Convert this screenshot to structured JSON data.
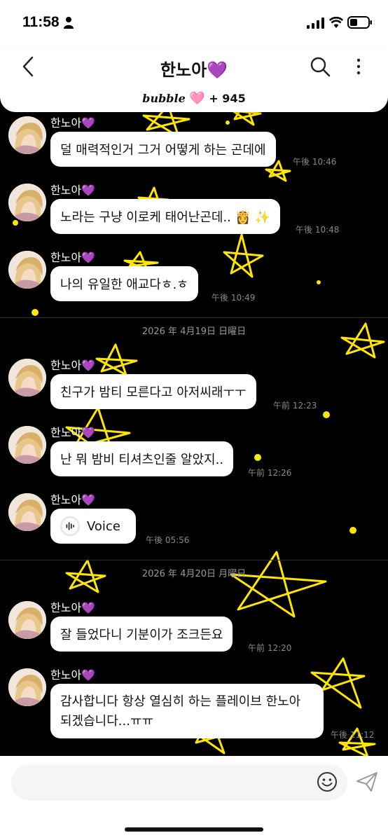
{
  "status": {
    "time": "11:58"
  },
  "header": {
    "title": "한노아💜",
    "bubble_word": "bubble",
    "bubble_heart": "🩷",
    "bubble_count": "+ 945"
  },
  "messages": [
    {
      "name": "한노아💜",
      "text": "덜 매력적인거 그거 어떻게 하는 곤데에",
      "time": "午後 10:46"
    },
    {
      "name": "한노아💜",
      "text": "노라는 구냥 이로케 태어난곤데.. 👸 ✨",
      "time": "午後 10:48"
    },
    {
      "name": "한노아💜",
      "text": "나의 유일한 애교다ㅎ.ㅎ",
      "time": "午後 10:49"
    },
    {
      "name": "한노아💜",
      "text": "친구가 밤티 모른다고 아저씨래ㅜㅜ",
      "time": "午前 12:23"
    },
    {
      "name": "한노아💜",
      "text": "난 뭐 밤비 티셔츠인줄 알았지..",
      "time": "午前 12:26"
    },
    {
      "name": "한노아💜",
      "text": "Voice",
      "time": "午後 05:56"
    },
    {
      "name": "한노아💜",
      "text": "잘 들었다니 기분이가 조크든요",
      "time": "午前 12:20"
    },
    {
      "name": "한노아💜",
      "text_line1": "감사합니다 항상 열심히 하는 플레이브 한노아",
      "text_line2": "되겠습니다...ㅠㅠ",
      "time": "午後 11:12"
    }
  ],
  "dates": [
    "2026 年 4月19日 日曜日",
    "2026 年 4月20日 月曜日"
  ],
  "input": {
    "placeholder": ""
  },
  "colors": {
    "chat_bg": "#000000",
    "star": "#ffe600",
    "bubble": "#ffffff"
  }
}
